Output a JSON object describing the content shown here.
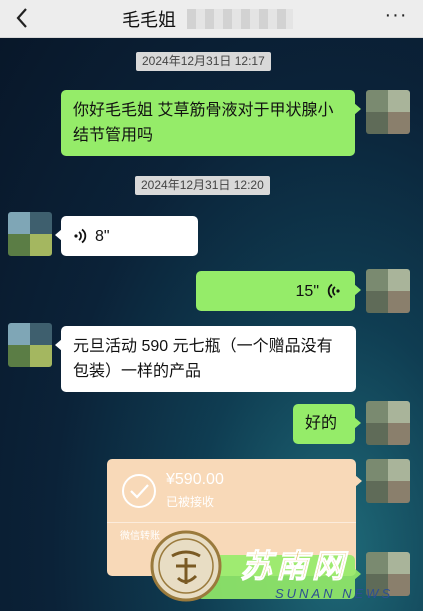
{
  "header": {
    "title": "毛毛姐",
    "back_icon": "chevron-left-icon",
    "more_label": "···"
  },
  "messages": [
    {
      "type": "timestamp",
      "text": "2024年12月31日 12:17"
    },
    {
      "type": "text",
      "from": "me",
      "text": "你好毛毛姐 艾草筋骨液对于甲状腺小结节管用吗"
    },
    {
      "type": "timestamp",
      "text": "2024年12月31日 12:20"
    },
    {
      "type": "voice",
      "from": "other",
      "duration": "8\""
    },
    {
      "type": "voice",
      "from": "me",
      "duration": "15\""
    },
    {
      "type": "text",
      "from": "other",
      "text": "元旦活动 590 元七瓶（一个赠品没有包装）一样的产品"
    },
    {
      "type": "text",
      "from": "me",
      "text": "好的"
    },
    {
      "type": "transfer",
      "from": "me",
      "amount": "¥590.00",
      "status": "已被接收",
      "footer": "微信转账"
    }
  ],
  "watermark": {
    "cn": "苏南网",
    "en": "SUNAN NEWS"
  },
  "colors": {
    "bubble_me": "#95ec69",
    "bubble_other": "#ffffff",
    "transfer_bg": "#f8d9b8"
  }
}
